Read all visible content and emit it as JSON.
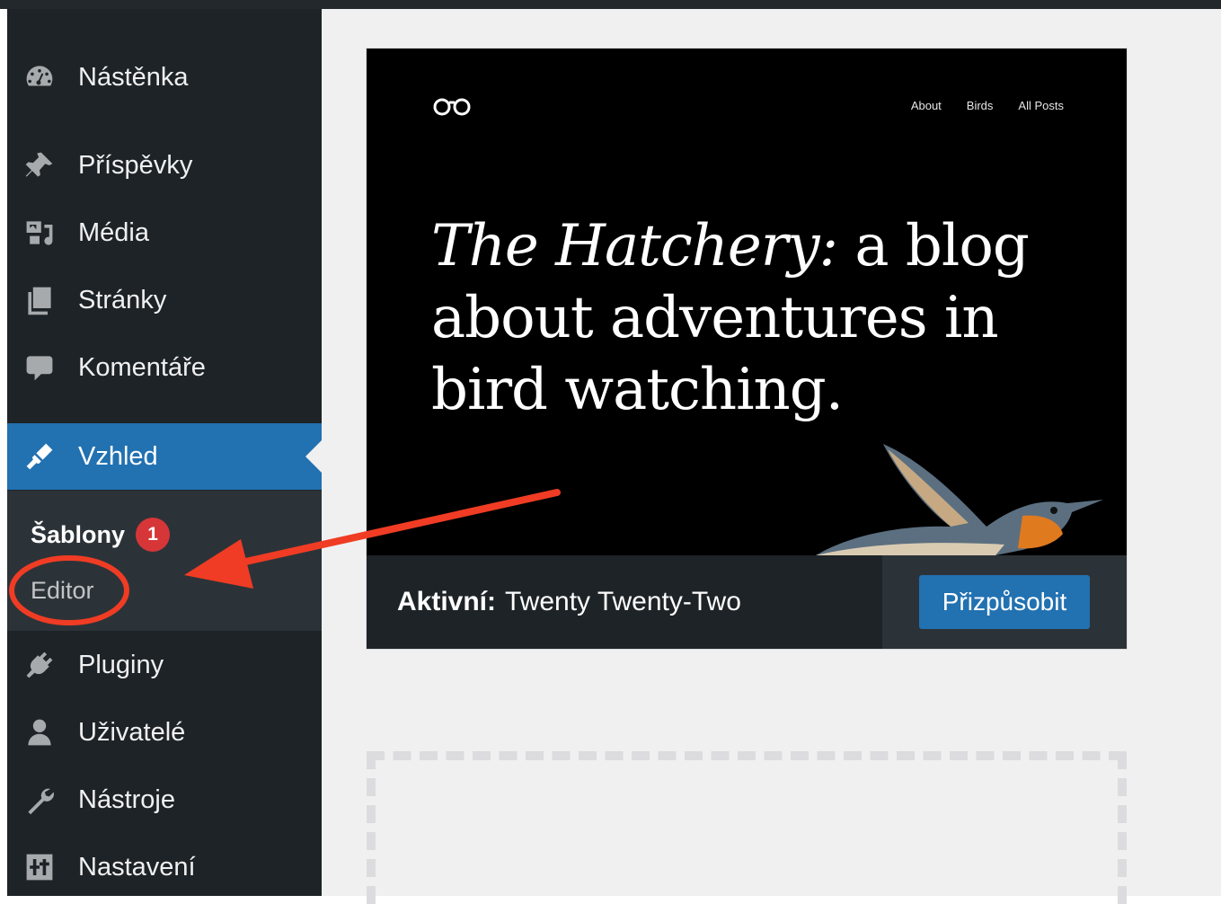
{
  "sidebar": {
    "items": [
      {
        "label": "Nástěnka",
        "icon": "dashboard-icon"
      },
      {
        "label": "Příspěvky",
        "icon": "pin-icon"
      },
      {
        "label": "Média",
        "icon": "media-icon"
      },
      {
        "label": "Stránky",
        "icon": "pages-icon"
      },
      {
        "label": "Komentáře",
        "icon": "comments-icon"
      },
      {
        "label": "Vzhled",
        "icon": "appearance-icon",
        "active": true
      },
      {
        "label": "Pluginy",
        "icon": "plugins-icon"
      },
      {
        "label": "Uživatelé",
        "icon": "users-icon"
      },
      {
        "label": "Nástroje",
        "icon": "tools-icon"
      },
      {
        "label": "Nastavení",
        "icon": "settings-icon"
      }
    ],
    "submenu": {
      "sablony_label": "Šablony",
      "sablony_badge": "1",
      "editor_label": "Editor"
    }
  },
  "theme_preview": {
    "nav": [
      "About",
      "Birds",
      "All Posts"
    ],
    "hero_em": "The Hatchery:",
    "hero_rest": " a blog about adventures in bird watching."
  },
  "active_theme": {
    "prefix": "Aktivní:",
    "name": "Twenty Twenty-Two",
    "customize_label": "Přizpůsobit"
  },
  "colors": {
    "sidebar_bg": "#1d2327",
    "submenu_bg": "#2c3338",
    "accent": "#2271b1",
    "badge": "#d63638",
    "annotation": "#f03c24"
  }
}
